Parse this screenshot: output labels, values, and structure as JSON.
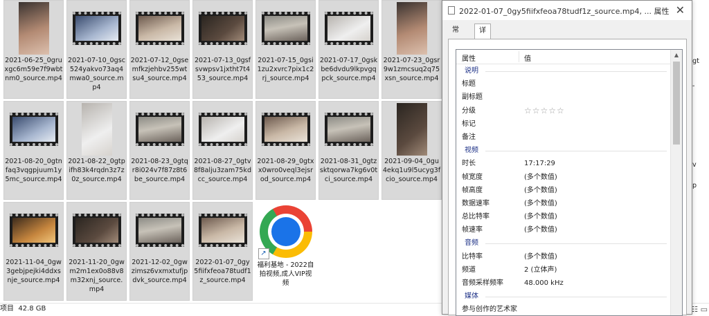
{
  "explorer": {
    "files": [
      {
        "name": "2021-06-25_0gruxgc6m59e7f9wbtnm0_source.mp4",
        "thumb": "portrait",
        "scene": "s-skin"
      },
      {
        "name": "2021-07-10_0gsc524yakvo73aq4mwa0_source.mp4",
        "thumb": "film",
        "scene": "s-blue"
      },
      {
        "name": "2021-07-12_0gsemfkzjehbv255wtsu4_source.mp4",
        "thumb": "film",
        "scene": "s-bed"
      },
      {
        "name": "2021-07-13_0gsfsvwpsv1jxtht7t453_source.mp4",
        "thumb": "film",
        "scene": "s-dark"
      },
      {
        "name": "2021-07-15_0gsi1zu2xvrc7pix1c2rj_source.mp4",
        "thumb": "film",
        "scene": "s-room"
      },
      {
        "name": "2021-07-17_0gskbe6dvdu9lkpvgqpck_source.mp4",
        "thumb": "film",
        "scene": "s-white"
      },
      {
        "name": "2021-07-23_0gsr9w1zmcsuq2q75xsn_source.mp4",
        "thumb": "portrait",
        "scene": "s-skin"
      },
      {
        "name": "2021-08-20_0gtnfaq3vqgpjuum1y5mc_source.mp4",
        "thumb": "film",
        "scene": "s-blue"
      },
      {
        "name": "2021-08-22_0gtpifh83k4rqdn3z7z0z_source.mp4",
        "thumb": "portrait",
        "scene": "s-white"
      },
      {
        "name": "2021-08-23_0gtqr8i024v7f87z8t6be_source.mp4",
        "thumb": "film",
        "scene": "s-room"
      },
      {
        "name": "2021-08-27_0gtv8f8alju3zam75kdcc_source.mp4",
        "thumb": "film",
        "scene": "s-white"
      },
      {
        "name": "2021-08-29_0gtxx0wro0veql3ejsrod_source.mp4",
        "thumb": "film",
        "scene": "s-bed"
      },
      {
        "name": "2021-08-31_0gtzsktqorwa7kg6v0tci_source.mp4",
        "thumb": "film",
        "scene": "s-room"
      },
      {
        "name": "2021-09-04_0gu4ekq1u9l5ucyg3fcio_source.mp4",
        "thumb": "portrait",
        "scene": "s-dark"
      },
      {
        "name": "2021-11-04_0gw3gebjpejki4ddxsnje_source.mp4",
        "thumb": "film",
        "scene": "s-warm"
      },
      {
        "name": "2021-11-20_0gwm2m1ex0o88v8m32xnj_source.mp4",
        "thumb": "film",
        "scene": "s-dark"
      },
      {
        "name": "2021-12-02_0gwzimsz6vxmxtufjpdvk_source.mp4",
        "thumb": "film",
        "scene": "s-room"
      },
      {
        "name": "2022-01-07_0gy5fiifxfeoa78tudf1z_source.mp4",
        "thumb": "film",
        "scene": "s-bed"
      },
      {
        "name": "福利基地 - 2022自拍视频,成人VIP视频",
        "thumb": "chrome",
        "scene": ""
      }
    ],
    "right_fragments": [
      "gt",
      "-",
      "v",
      "p"
    ]
  },
  "status": {
    "items": "项目",
    "size": "42.8 GB",
    "view_icons": "☷ ▭"
  },
  "dialog": {
    "title": "2022-01-07_0gy5fiifxfeoa78tudf1z_source.mp4, ... 属性",
    "tabs": [
      "常规",
      "详细信息"
    ],
    "header": {
      "name": "属性",
      "value": "值"
    },
    "sections": [
      {
        "label": "说明",
        "rows": [
          {
            "k": "标题",
            "v": ""
          },
          {
            "k": "副标题",
            "v": ""
          },
          {
            "k": "分级",
            "v": "☆☆☆☆☆"
          },
          {
            "k": "标记",
            "v": ""
          },
          {
            "k": "备注",
            "v": ""
          }
        ]
      },
      {
        "label": "视频",
        "rows": [
          {
            "k": "时长",
            "v": "17:17:29"
          },
          {
            "k": "帧宽度",
            "v": "(多个数值)"
          },
          {
            "k": "帧高度",
            "v": "(多个数值)"
          },
          {
            "k": "数据速率",
            "v": "(多个数值)"
          },
          {
            "k": "总比特率",
            "v": "(多个数值)"
          },
          {
            "k": "帧速率",
            "v": "(多个数值)"
          }
        ]
      },
      {
        "label": "音频",
        "rows": [
          {
            "k": "比特率",
            "v": "(多个数值)"
          },
          {
            "k": "频道",
            "v": "2 (立体声)"
          },
          {
            "k": "音频采样频率",
            "v": "48.000 kHz"
          }
        ]
      },
      {
        "label": "媒体",
        "rows": [
          {
            "k": "参与创作的艺术家",
            "v": ""
          }
        ]
      }
    ]
  }
}
